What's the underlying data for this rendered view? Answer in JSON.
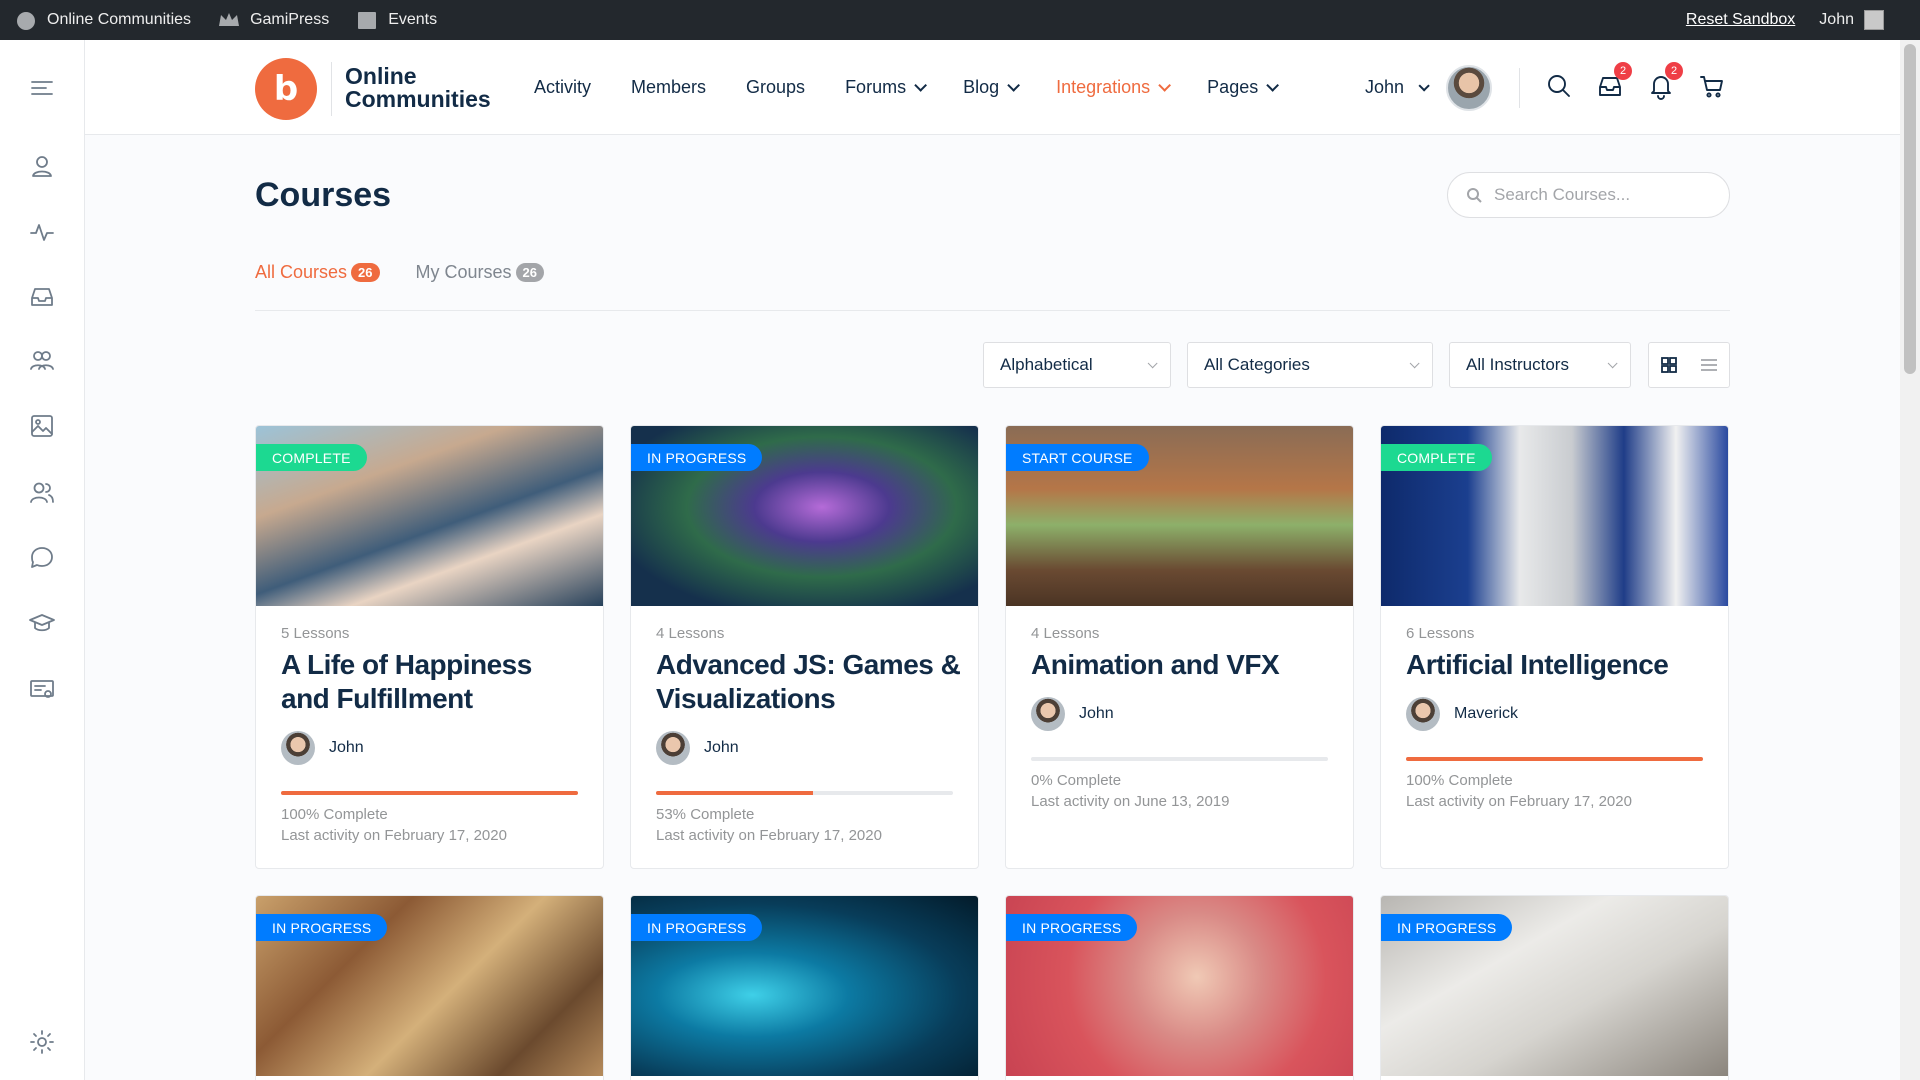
{
  "adminbar": {
    "site_name": "Online Communities",
    "gamipress": "GamiPress",
    "events": "Events",
    "reset": "Reset Sandbox",
    "user": "John"
  },
  "header": {
    "logo_mark": "b",
    "logo_line1": "Online",
    "logo_line2": "Communities",
    "nav": [
      "Activity",
      "Members",
      "Groups",
      "Forums",
      "Blog",
      "Integrations",
      "Pages"
    ],
    "user_name": "John",
    "messages_badge": "2",
    "notifications_badge": "2"
  },
  "page": {
    "title": "Courses",
    "search_placeholder": "Search Courses...",
    "tabs": [
      {
        "label": "All Courses",
        "count": "26"
      },
      {
        "label": "My Courses",
        "count": "26"
      }
    ],
    "filters": {
      "order": "Alphabetical",
      "category": "All Categories",
      "instructor": "All Instructors"
    }
  },
  "courses": [
    {
      "status": "COMPLETE",
      "lessons": "5 Lessons",
      "title": "A Life of Happiness and Fulfillment",
      "author": "John",
      "progress": 100,
      "progress_text": "100% Complete",
      "activity": "Last activity on February 17, 2020"
    },
    {
      "status": "IN PROGRESS",
      "lessons": "4 Lessons",
      "title": "Advanced JS: Games & Visualizations",
      "author": "John",
      "progress": 53,
      "progress_text": "53% Complete",
      "activity": "Last activity on February 17, 2020"
    },
    {
      "status": "START COURSE",
      "lessons": "4 Lessons",
      "title": "Animation and VFX",
      "author": "John",
      "progress": 0,
      "progress_text": "0% Complete",
      "activity": "Last activity on June 13, 2019"
    },
    {
      "status": "COMPLETE",
      "lessons": "6 Lessons",
      "title": "Artificial Intelligence",
      "author": "Maverick",
      "progress": 100,
      "progress_text": "100% Complete",
      "activity": "Last activity on February 17, 2020"
    },
    {
      "status": "IN PROGRESS"
    },
    {
      "status": "IN PROGRESS"
    },
    {
      "status": "IN PROGRESS"
    },
    {
      "status": "IN PROGRESS"
    }
  ],
  "colors": {
    "accent": "#ef6b3f",
    "complete": "#1cd991",
    "progress": "#007cff",
    "text": "#122b46"
  }
}
